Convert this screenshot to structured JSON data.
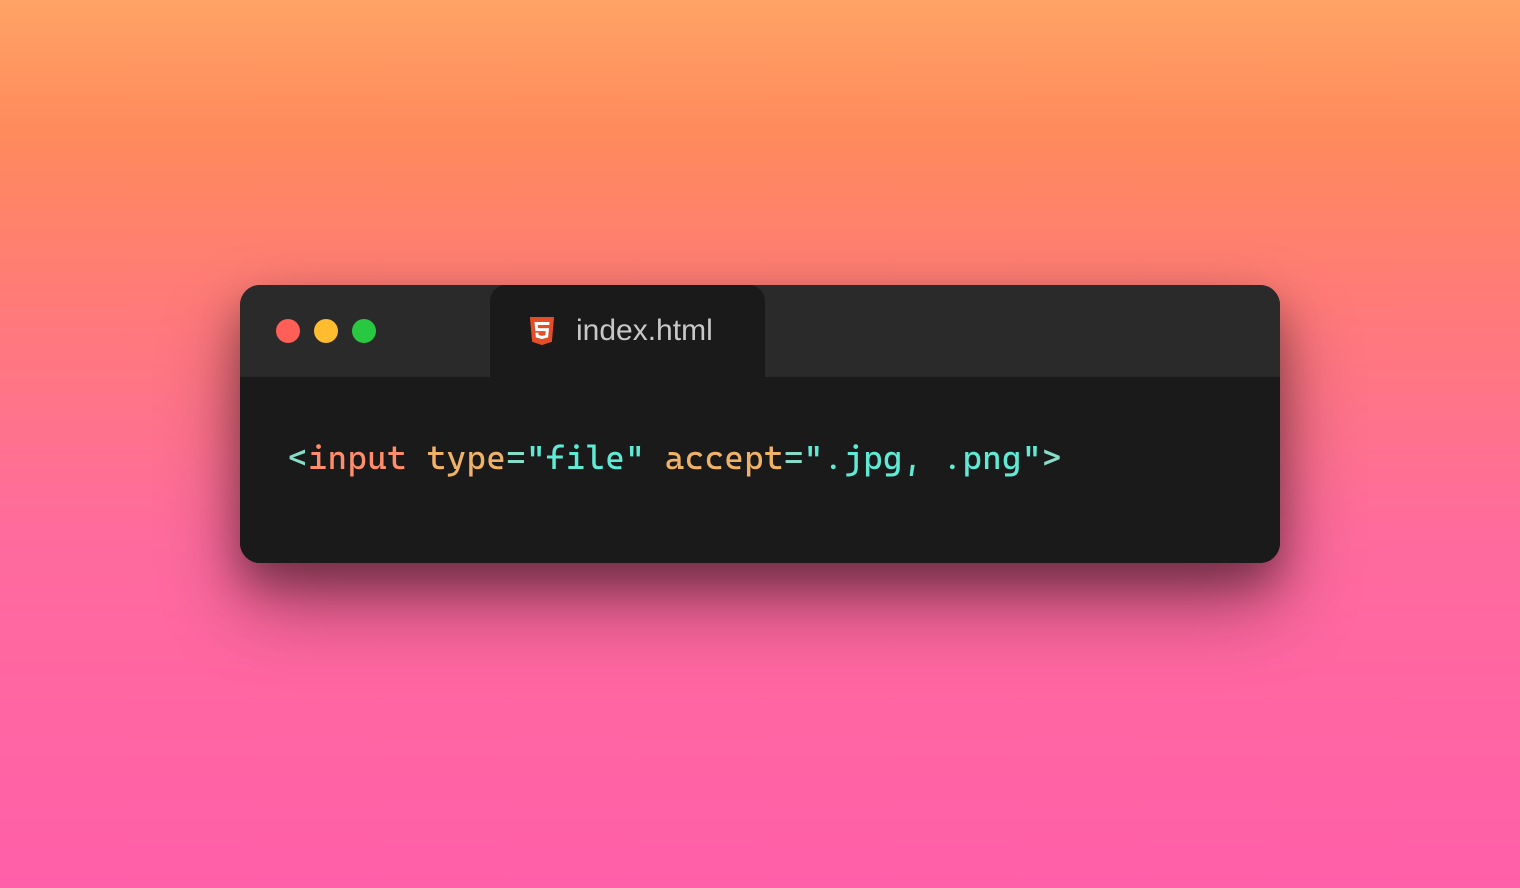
{
  "tab": {
    "title": "index.html",
    "icon": "html5-icon"
  },
  "traffic_lights": {
    "close": "red",
    "minimize": "yellow",
    "maximize": "green"
  },
  "code": {
    "tokens": {
      "open_bracket": "<",
      "tag": "input",
      "attr1": "type",
      "eq1": "=",
      "val1": "\"file\"",
      "attr2": "accept",
      "eq2": "=",
      "val2": "\".jpg, .png\"",
      "close_bracket": ">"
    }
  }
}
